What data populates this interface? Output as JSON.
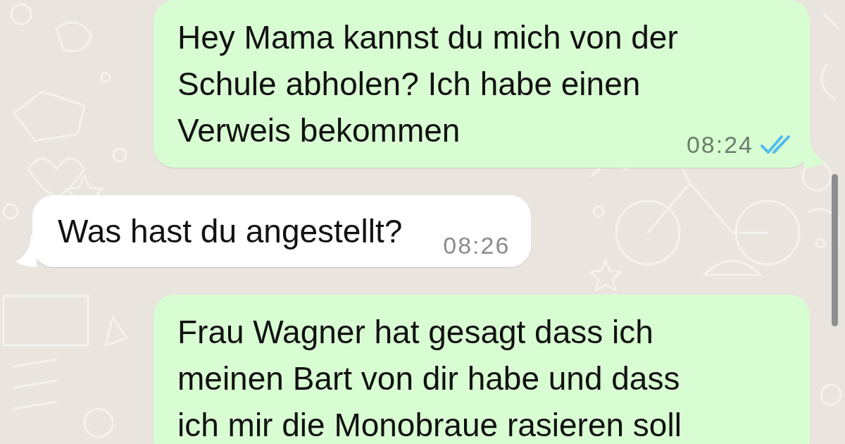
{
  "messages": [
    {
      "kind": "sent",
      "lines": [
        "Hey Mama kannst du mich von der",
        "Schule abholen? Ich habe einen",
        "Verweis bekommen"
      ],
      "time": "08:24",
      "read": true,
      "tail": true
    },
    {
      "kind": "received",
      "lines": [
        "Was hast du angestellt?"
      ],
      "time": "08:26",
      "tail": true
    },
    {
      "kind": "sent",
      "lines": [
        "Frau Wagner hat gesagt dass ich",
        "meinen Bart von dir habe und dass",
        "ich mir die Monobraue rasieren soll"
      ],
      "tail": false
    }
  ]
}
